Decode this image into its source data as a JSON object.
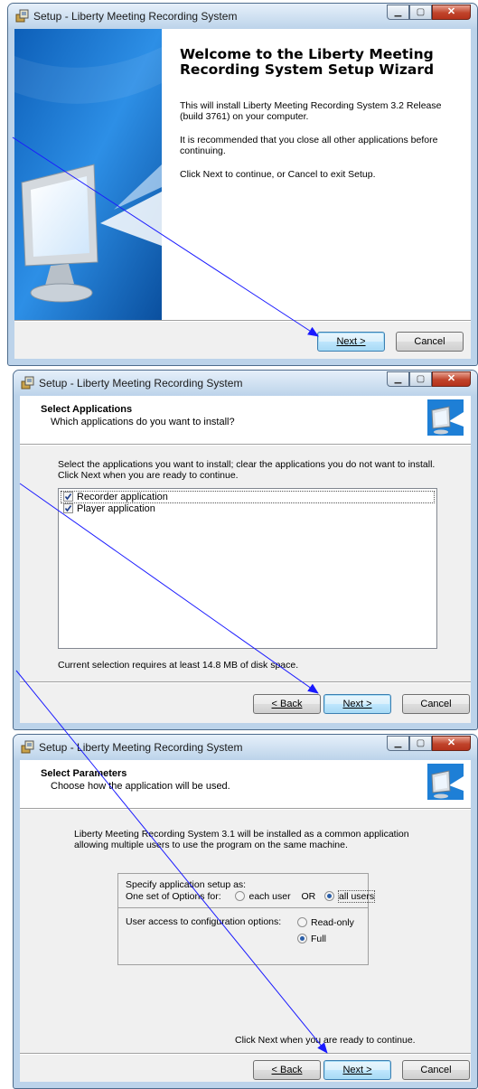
{
  "win1": {
    "title": "Setup - Liberty Meeting Recording System",
    "heading": "Welcome to the Liberty Meeting Recording System Setup Wizard",
    "para1": "This will install Liberty Meeting Recording System 3.2 Release (build 3761) on your computer.",
    "para2": "It is recommended that you close all other applications before continuing.",
    "para3": "Click Next to continue, or Cancel to exit Setup.",
    "next_label": "Next >",
    "cancel_label": "Cancel"
  },
  "win2": {
    "title": "Setup - Liberty Meeting Recording System",
    "header_title": "Select Applications",
    "header_subtitle": "Which applications do you want to install?",
    "instructions": "Select the applications you want to install; clear the applications you do not want to install. Click Next when you are ready to continue.",
    "items": [
      {
        "label": "Recorder application",
        "checked": true
      },
      {
        "label": "Player application",
        "checked": true
      }
    ],
    "disk_space": "Current selection requires at least 14.8 MB of disk space.",
    "back_label": "< Back",
    "next_label": "Next >",
    "cancel_label": "Cancel"
  },
  "win3": {
    "title": "Setup - Liberty Meeting Recording System",
    "header_title": "Select Parameters",
    "header_subtitle": "Choose how the application will be used.",
    "description": "Liberty Meeting Recording System 3.1 will be installed as a common application allowing multiple users to use the program on the same machine.",
    "specify_label": "Specify application setup as:",
    "options_for_label": "One set of Options for:",
    "each_user_label": "each user",
    "or_label": "OR",
    "all_users_label": "all users",
    "access_label": "User access to configuration options:",
    "readonly_label": "Read-only",
    "full_label": "Full",
    "footer_text": "Click Next when you are ready to continue.",
    "back_label": "< Back",
    "next_label": "Next >",
    "cancel_label": "Cancel"
  },
  "colors": {
    "annotation_arrow": "#1a1aff",
    "banner_blue": "#1e7fd6",
    "close_red": "#c0432a"
  }
}
